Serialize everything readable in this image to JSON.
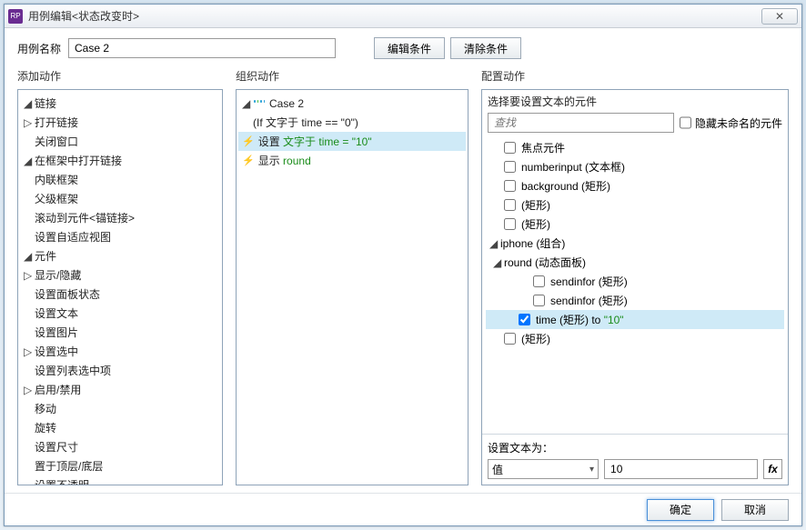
{
  "window": {
    "title": "用例编辑<状态改变时>",
    "close_label": "✕"
  },
  "top": {
    "case_name_label": "用例名称",
    "case_name_value": "Case 2",
    "edit_cond": "编辑条件",
    "clear_cond": "清除条件"
  },
  "headers": {
    "add_actions": "添加动作",
    "organize": "组织动作",
    "configure": "配置动作"
  },
  "left_tree": {
    "g1": "链接",
    "g1_items": {
      "open_link": "打开链接",
      "close_win": "关闭窗口",
      "open_in_frame": "在框架中打开链接",
      "inline_frame": "内联框架",
      "parent_frame": "父级框架",
      "scroll_anchor": "滚动到元件<锚链接>",
      "set_adaptive": "设置自适应视图"
    },
    "g2": "元件",
    "g2_items": {
      "show_hide": "显示/隐藏",
      "panel_state": "设置面板状态",
      "set_text": "设置文本",
      "set_image": "设置图片",
      "set_selected": "设置选中",
      "set_list_sel": "设置列表选中项",
      "enable_disable": "启用/禁用",
      "move": "移动",
      "rotate": "旋转",
      "set_size": "设置尺寸",
      "bring_front_back": "置于顶层/底层",
      "set_opacity": "设置不透明"
    }
  },
  "org": {
    "case_label": "Case 2",
    "condition": "(If 文字于 time == \"0\")",
    "action1_prefix": "设置 ",
    "action1_green": "文字于 time = \"10\"",
    "action2_prefix": "显示 ",
    "action2_green": "round"
  },
  "cfg": {
    "section_title": "选择要设置文本的元件",
    "search_placeholder": "查找",
    "hide_unnamed": "隐藏未命名的元件",
    "items": {
      "focus": "焦点元件",
      "numberinput": "numberinput (文本框)",
      "background": "background (矩形)",
      "rect1": "(矩形)",
      "rect2": "(矩形)",
      "iphone": "iphone (组合)",
      "round": "round (动态面板)",
      "sendinfor1": "sendinfor (矩形)",
      "sendinfor2": "sendinfor (矩形)",
      "time_prefix": "time (矩形) to ",
      "time_value": "\"10\"",
      "rect3": "(矩形)"
    },
    "set_text_label": "设置文本为：",
    "mode_value": "值",
    "value": "10",
    "fx": "fx"
  },
  "footer": {
    "ok": "确定",
    "cancel": "取消"
  }
}
